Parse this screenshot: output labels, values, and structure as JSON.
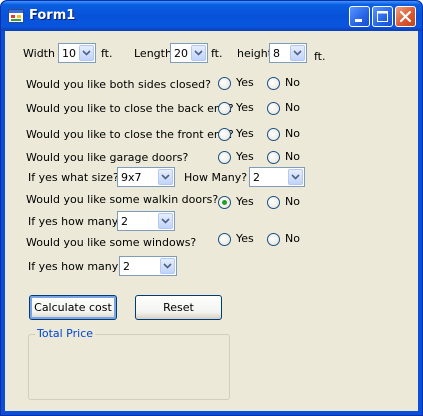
{
  "window": {
    "title": "Form1"
  },
  "dimensions": {
    "width_label": "Width",
    "width_value": "10",
    "width_unit": "ft.",
    "length_label": "Length",
    "length_value": "20",
    "length_unit": "ft.",
    "height_label": "height",
    "height_value": "8",
    "height_unit": "ft."
  },
  "radio_labels": {
    "yes": "Yes",
    "no": "No"
  },
  "questions": {
    "both_sides": "Would you like both sides closed?",
    "back_end": "Would you like to close the back end?",
    "front_end": "Would you like to close the front end?",
    "garage_doors": "Would you like garage doors?",
    "walkin_doors": "Would you like some walkin doors?",
    "windows": "Would you like some windows?"
  },
  "garage": {
    "size_label": "If yes what size?",
    "size_value": "9x7",
    "count_label": "How Many?",
    "count_value": "2"
  },
  "walkin": {
    "count_label": "If yes how many?",
    "count_value": "2",
    "selected": "Yes"
  },
  "windows": {
    "count_label": "If yes how many?",
    "count_value": "2"
  },
  "buttons": {
    "calculate": "Calculate cost",
    "reset": "Reset"
  },
  "total": {
    "group_label": "Total Price"
  },
  "colors": {
    "titlebar": "#0752d8",
    "form_background": "#ece9d8",
    "group_label": "#0046d5",
    "radio_selected": "#21a121"
  },
  "icons": [
    "app-icon",
    "minimize-icon",
    "maximize-icon",
    "close-icon",
    "chevron-down-icon"
  ]
}
